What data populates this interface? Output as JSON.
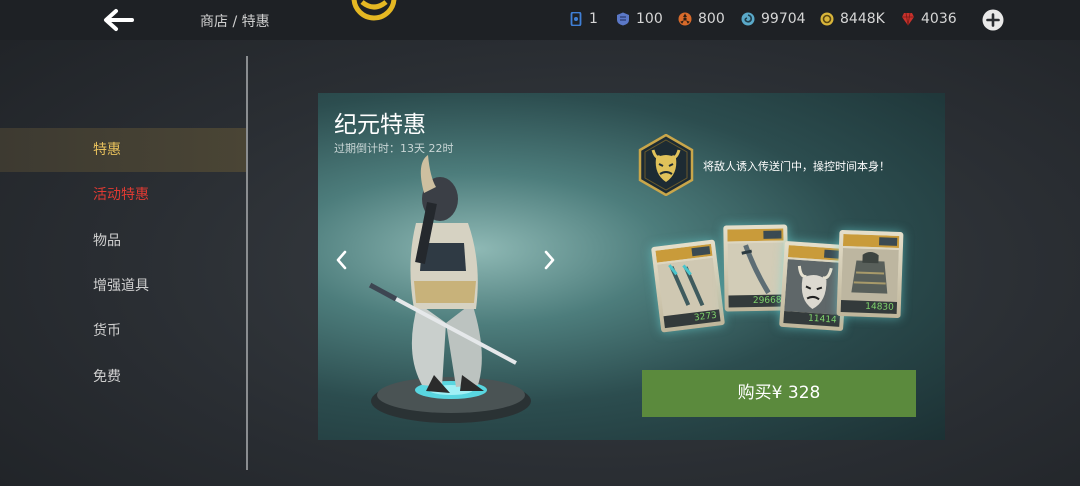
{
  "header": {
    "breadcrumb": "商店 / 特惠",
    "resources": [
      {
        "name": "card-icon",
        "value": "1",
        "color": "#3f7fd6"
      },
      {
        "name": "steel-icon",
        "value": "100",
        "color": "#5b78c7"
      },
      {
        "name": "hazard-icon",
        "value": "800",
        "color": "#d86a2a"
      },
      {
        "name": "swirl-icon",
        "value": "99704",
        "color": "#5aa9c9"
      },
      {
        "name": "coin-icon",
        "value": "8448K",
        "color": "#d9b53a"
      },
      {
        "name": "gem-icon",
        "value": "4036",
        "color": "#c8322c"
      }
    ]
  },
  "sidebar": {
    "items": [
      {
        "label": "特惠",
        "state": "active"
      },
      {
        "label": "活动特惠",
        "state": "hot"
      },
      {
        "label": "物品",
        "state": "normal"
      },
      {
        "label": "增强道具",
        "state": "normal"
      },
      {
        "label": "货币",
        "state": "normal"
      },
      {
        "label": "免费",
        "state": "normal"
      }
    ]
  },
  "offer": {
    "title": "纪元特惠",
    "countdown": "过期倒计时：13天 22时",
    "description": "将敌人诱入传送门中，操控时间本身！",
    "cards": [
      {
        "art": "blades",
        "price": "3273"
      },
      {
        "art": "sword",
        "price": "29668"
      },
      {
        "art": "demon-mask",
        "price": "11414"
      },
      {
        "art": "armor",
        "price": "14830"
      }
    ],
    "buy_label": "购买¥ 328"
  },
  "colors": {
    "accent": "#e7c05c",
    "hot": "#e03a33",
    "buy": "#5b8a3d",
    "price": "#7fd36b"
  }
}
